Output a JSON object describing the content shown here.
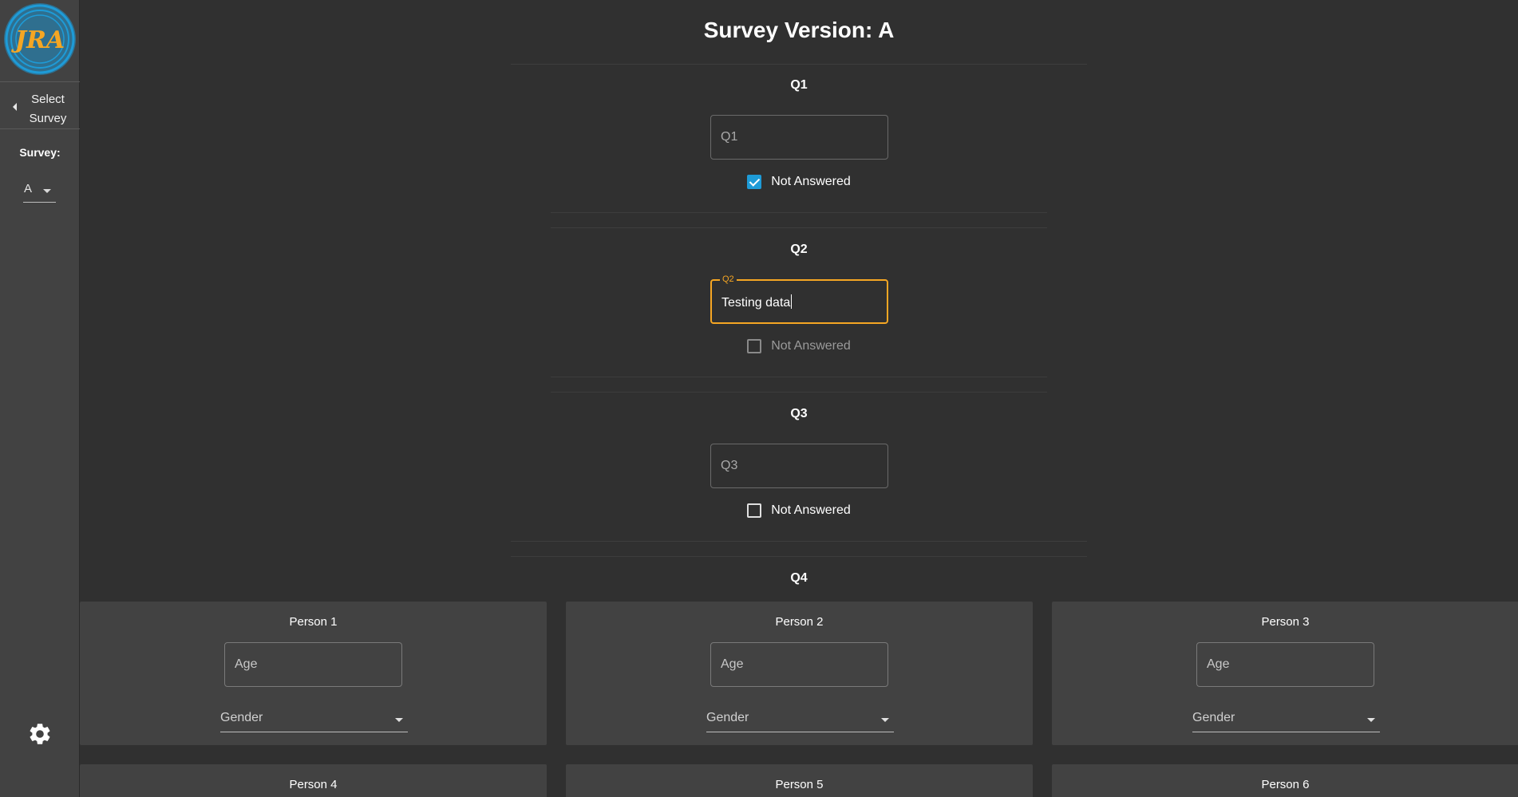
{
  "app": {
    "logo_text": "JRA",
    "logo_ring_color": "#1e9bd7",
    "logo_text_color": "#f5a623"
  },
  "sidebar": {
    "select_survey_line1": "Select",
    "select_survey_line2": "Survey",
    "survey_label": "Survey:",
    "survey_value": "A",
    "settings_icon": "gear-icon"
  },
  "main": {
    "title": "Survey Version: A",
    "questions": [
      {
        "label": "Q1",
        "placeholder": "Q1",
        "value": "",
        "not_answered_label": "Not Answered",
        "not_answered_checked": true
      },
      {
        "label": "Q2",
        "floating_label": "Q2",
        "value": "Testing data",
        "not_answered_label": "Not Answered",
        "not_answered_checked": false
      },
      {
        "label": "Q3",
        "placeholder": "Q3",
        "value": "",
        "not_answered_label": "Not Answered",
        "not_answered_checked": false
      }
    ],
    "q4": {
      "label": "Q4",
      "persons": [
        {
          "title": "Person 1",
          "age_placeholder": "Age",
          "gender_placeholder": "Gender"
        },
        {
          "title": "Person 2",
          "age_placeholder": "Age",
          "gender_placeholder": "Gender"
        },
        {
          "title": "Person 3",
          "age_placeholder": "Age",
          "gender_placeholder": "Gender"
        },
        {
          "title": "Person 4"
        },
        {
          "title": "Person 5"
        },
        {
          "title": "Person 6"
        }
      ]
    }
  },
  "colors": {
    "accent_focus": "#f5a623",
    "checkbox_checked": "#1e9bd7",
    "background": "#303030",
    "panel": "#424242"
  }
}
